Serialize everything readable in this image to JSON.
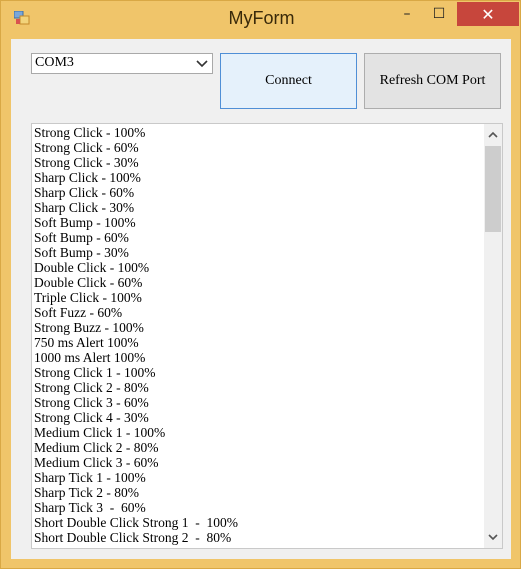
{
  "window": {
    "title": "MyForm",
    "minimize_label": "–",
    "maximize_label": "☐",
    "close_label": "✕"
  },
  "port_select": {
    "value": "COM3"
  },
  "buttons": {
    "connect_label": "Connect",
    "refresh_label": "Refresh COM Port"
  },
  "effects_list": {
    "items": [
      "Strong Click - 100%",
      "Strong Click - 60%",
      "Strong Click - 30%",
      "Sharp Click - 100%",
      "Sharp Click - 60%",
      "Sharp Click - 30%",
      "Soft Bump - 100%",
      "Soft Bump - 60%",
      "Soft Bump - 30%",
      "Double Click - 100%",
      "Double Click - 60%",
      "Triple Click - 100%",
      "Soft Fuzz - 60%",
      "Strong Buzz - 100%",
      "750 ms Alert 100%",
      "1000 ms Alert 100%",
      "Strong Click 1 - 100%",
      "Strong Click 2 - 80%",
      "Strong Click 3 - 60%",
      "Strong Click 4 - 30%",
      "Medium Click 1 - 100%",
      "Medium Click 2 - 80%",
      "Medium Click 3 - 60%",
      "Sharp Tick 1 - 100%",
      "Sharp Tick 2 - 80%",
      "Sharp Tick 3  -  60%",
      "Short Double Click Strong 1  -  100%",
      "Short Double Click Strong 2  -  80%"
    ]
  },
  "colors": {
    "frame": "#f0c56a",
    "close_button": "#c7463c",
    "connect_border": "#4f8fd6"
  },
  "icons": {
    "app": "app-icon",
    "dropdown": "chevron-down-icon",
    "scroll_up": "chevron-up-icon",
    "scroll_down": "chevron-down-icon"
  }
}
